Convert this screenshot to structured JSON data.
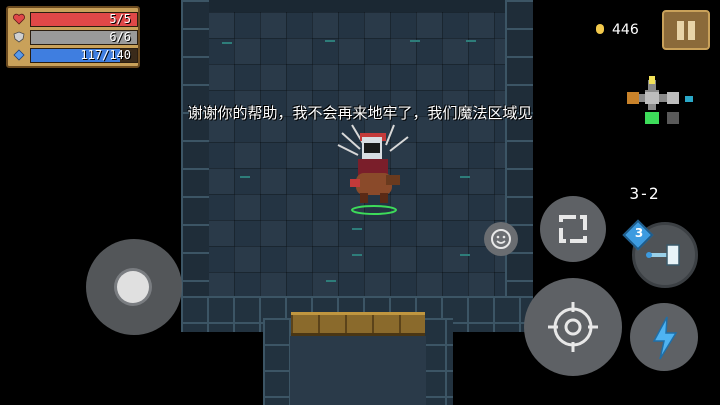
{
  "hud": {
    "health": {
      "label": "5/5",
      "current": 5,
      "max": 5,
      "color": "#e04848"
    },
    "armor": {
      "label": "6/6",
      "current": 6,
      "max": 6,
      "color": "#9a9a9a"
    },
    "energy": {
      "label": "117/140",
      "current": 117,
      "max": 140,
      "color": "#3f7ee0"
    },
    "coins": "446",
    "coin_color": "#f2c94c"
  },
  "dialog": {
    "text": "谢谢你的帮助，我不会再来地牢了，我们魔法区域见"
  },
  "level": "3-2",
  "minimap": {
    "rooms": [
      "start-room",
      "treasure-room",
      "current-room",
      "portal-room",
      "exit-room"
    ]
  },
  "controls": {
    "weapon_energy_cost": "3",
    "icons": {
      "joystick": "joystick-knob",
      "swap": "swap-weapon-icon",
      "emote": "smile-icon",
      "attack": "crosshair-icon",
      "skill": "lightning-icon",
      "pause": "pause-icon",
      "weapon": "hammer-icon"
    }
  }
}
